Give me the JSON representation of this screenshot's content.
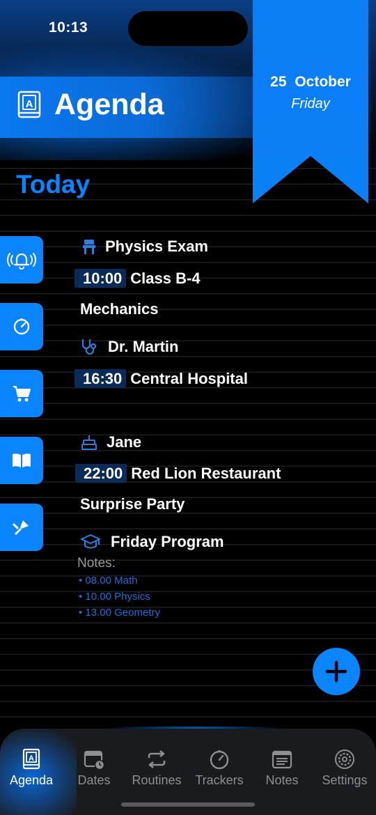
{
  "status_bar": {
    "time": "10:13"
  },
  "header": {
    "title": "Agenda",
    "icon": "agenda-book-icon"
  },
  "date_ribbon": {
    "day_number": "25",
    "month": "October",
    "weekday": "Friday"
  },
  "section_title": "Today",
  "side_actions": [
    {
      "name": "alarm-button",
      "icon": "bell-ringing-icon"
    },
    {
      "name": "timer-button",
      "icon": "timer-icon"
    },
    {
      "name": "shopping-button",
      "icon": "cart-icon"
    },
    {
      "name": "reading-button",
      "icon": "open-book-icon"
    },
    {
      "name": "tools-button",
      "icon": "paint-brush-icon"
    }
  ],
  "events": [
    {
      "icon": "school-desk-icon",
      "title": "Physics Exam",
      "time": "10:00",
      "location": "Class B-4",
      "detail": "Mechanics"
    },
    {
      "icon": "stethoscope-icon",
      "title": "Dr. Martin",
      "time": "16:30",
      "location": "Central Hospital"
    },
    {
      "icon": "birthday-cake-icon",
      "title": "Jane",
      "time": "22:00",
      "location": "Red Lion Restaurant",
      "detail": "Surprise Party"
    },
    {
      "icon": "graduation-cap-icon",
      "title": "Friday Program",
      "notes_label": "Notes:",
      "notes": [
        "• 08.00 Math",
        "• 10.00 Physics",
        "• 13.00 Geometry"
      ]
    }
  ],
  "tabs": [
    {
      "label": "Agenda",
      "icon": "agenda-book-icon",
      "active": true
    },
    {
      "label": "Dates",
      "icon": "calendar-clock-icon"
    },
    {
      "label": "Routines",
      "icon": "repeat-arrows-icon"
    },
    {
      "label": "Trackers",
      "icon": "timer-icon"
    },
    {
      "label": "Notes",
      "icon": "notes-icon"
    },
    {
      "label": "Settings",
      "icon": "gear-icon"
    }
  ],
  "colors": {
    "accent": "#0a84ff",
    "background": "#000000",
    "tab_inactive": "#8e8e93"
  }
}
